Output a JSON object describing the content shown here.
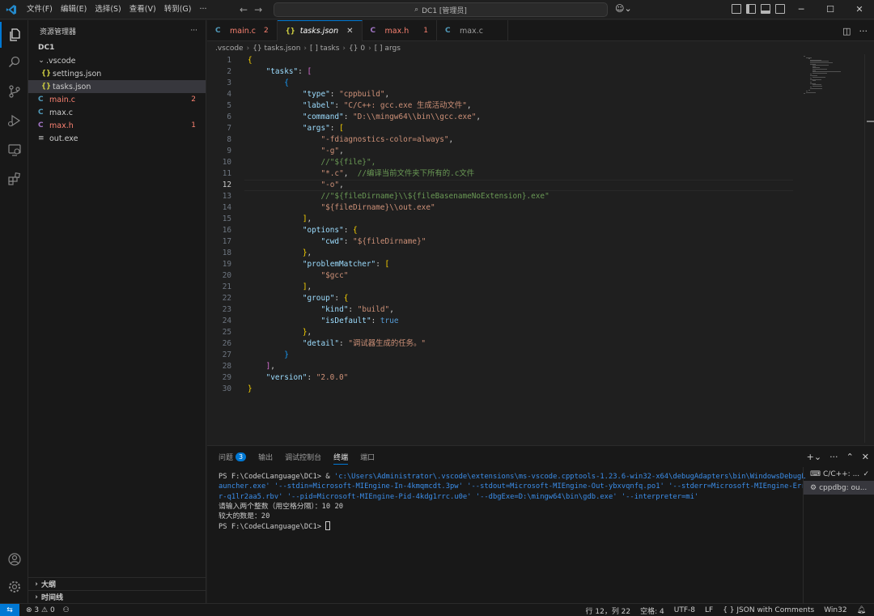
{
  "titlebar": {
    "menus": [
      "文件(F)",
      "编辑(E)",
      "选择(S)",
      "查看(V)",
      "转到(G)",
      "···"
    ],
    "command_center": "DC1 [管理员]",
    "window_controls": [
      "─",
      "☐",
      "✕"
    ]
  },
  "sidebar": {
    "title": "资源管理器",
    "more": "···",
    "root": "DC1",
    "tree": [
      {
        "label": ".vscode",
        "type": "folder",
        "depth": 1
      },
      {
        "label": "settings.json",
        "type": "json",
        "depth": 2
      },
      {
        "label": "tasks.json",
        "type": "json",
        "depth": 2,
        "selected": true
      },
      {
        "label": "main.c",
        "type": "c",
        "depth": 1,
        "badge": "2",
        "error": true
      },
      {
        "label": "max.c",
        "type": "c",
        "depth": 1
      },
      {
        "label": "max.h",
        "type": "h",
        "depth": 1,
        "badge": "1",
        "error": true
      },
      {
        "label": "out.exe",
        "type": "exe",
        "depth": 1
      }
    ],
    "outline": "大纲",
    "timeline": "时间线"
  },
  "tabs": [
    {
      "label": "main.c",
      "icon": "C",
      "badge": "2",
      "active": false
    },
    {
      "label": "tasks.json",
      "icon": "{}",
      "active": true,
      "close": "✕"
    },
    {
      "label": "max.h",
      "icon": "C",
      "badge": "1",
      "active": false
    },
    {
      "label": "max.c",
      "icon": "C",
      "active": false
    }
  ],
  "breadcrumb": [
    ".vscode",
    "{} tasks.json",
    "[ ] tasks",
    "{} 0",
    "[ ] args"
  ],
  "editor": {
    "current_line": 12,
    "lines": [
      "{",
      "    \"tasks\": [",
      "        {",
      "            \"type\": \"cppbuild\",",
      "            \"label\": \"C/C++: gcc.exe 生成活动文件\",",
      "            \"command\": \"D:\\\\mingw64\\\\bin\\\\gcc.exe\",",
      "            \"args\": [",
      "                \"-fdiagnostics-color=always\",",
      "                \"-g\",",
      "                //\"${file}\",",
      "                \"*.c\",  //编译当前文件夹下所有的.c文件",
      "                \"-o\",",
      "                //\"${fileDirname}\\\\${fileBasenameNoExtension}.exe\"",
      "                \"${fileDirname}\\\\out.exe\"",
      "            ],",
      "            \"options\": {",
      "                \"cwd\": \"${fileDirname}\"",
      "            },",
      "            \"problemMatcher\": [",
      "                \"$gcc\"",
      "            ],",
      "            \"group\": {",
      "                \"kind\": \"build\",",
      "                \"isDefault\": true",
      "            },",
      "            \"detail\": \"调试器生成的任务。\"",
      "        }",
      "    ],",
      "    \"version\": \"2.0.0\"",
      "}"
    ]
  },
  "panel": {
    "tabs": [
      {
        "label": "问题",
        "count": "3"
      },
      {
        "label": "输出"
      },
      {
        "label": "调试控制台"
      },
      {
        "label": "终端",
        "active": true
      },
      {
        "label": "端口"
      }
    ],
    "terminal": {
      "line1_prompt": "PS F:\\CodeCLanguage\\DC1> ",
      "line1_amp": "& ",
      "line1_path": "'c:\\Users\\Administrator\\.vscode\\extensions\\ms-vscode.cpptools-1.23.6-win32-x64\\debugAdapters\\bin\\WindowsDebugL",
      "line2": "auncher.exe' '--stdin=Microsoft-MIEngine-In-4kmqmcdt.3pw' '--stdout=Microsoft-MIEngine-Out-ybxvqnfq.po1' '--stderr=Microsoft-MIEngine-Erro",
      "line3": "r-q1lr2aa5.rbv' '--pid=Microsoft-MIEngine-Pid-4kdg1rrc.u0e' '--dbgExe=D:\\mingw64\\bin\\gdb.exe' '--interpreter=mi'",
      "line4": "请输入两个整数（用空格分隔）：10 20",
      "line5": "较大的数是：20",
      "line6": "PS F:\\CodeCLanguage\\DC1> "
    },
    "terminal_list": [
      "C/C++: ...",
      "cppdbg: ou..."
    ]
  },
  "statusbar": {
    "remote": "⇆",
    "errors": "3",
    "warnings": "0",
    "cursor": "行 12，列 22",
    "spaces": "空格: 4",
    "encoding": "UTF-8",
    "eol": "LF",
    "language": "JSON with Comments",
    "platform": "Win32"
  }
}
